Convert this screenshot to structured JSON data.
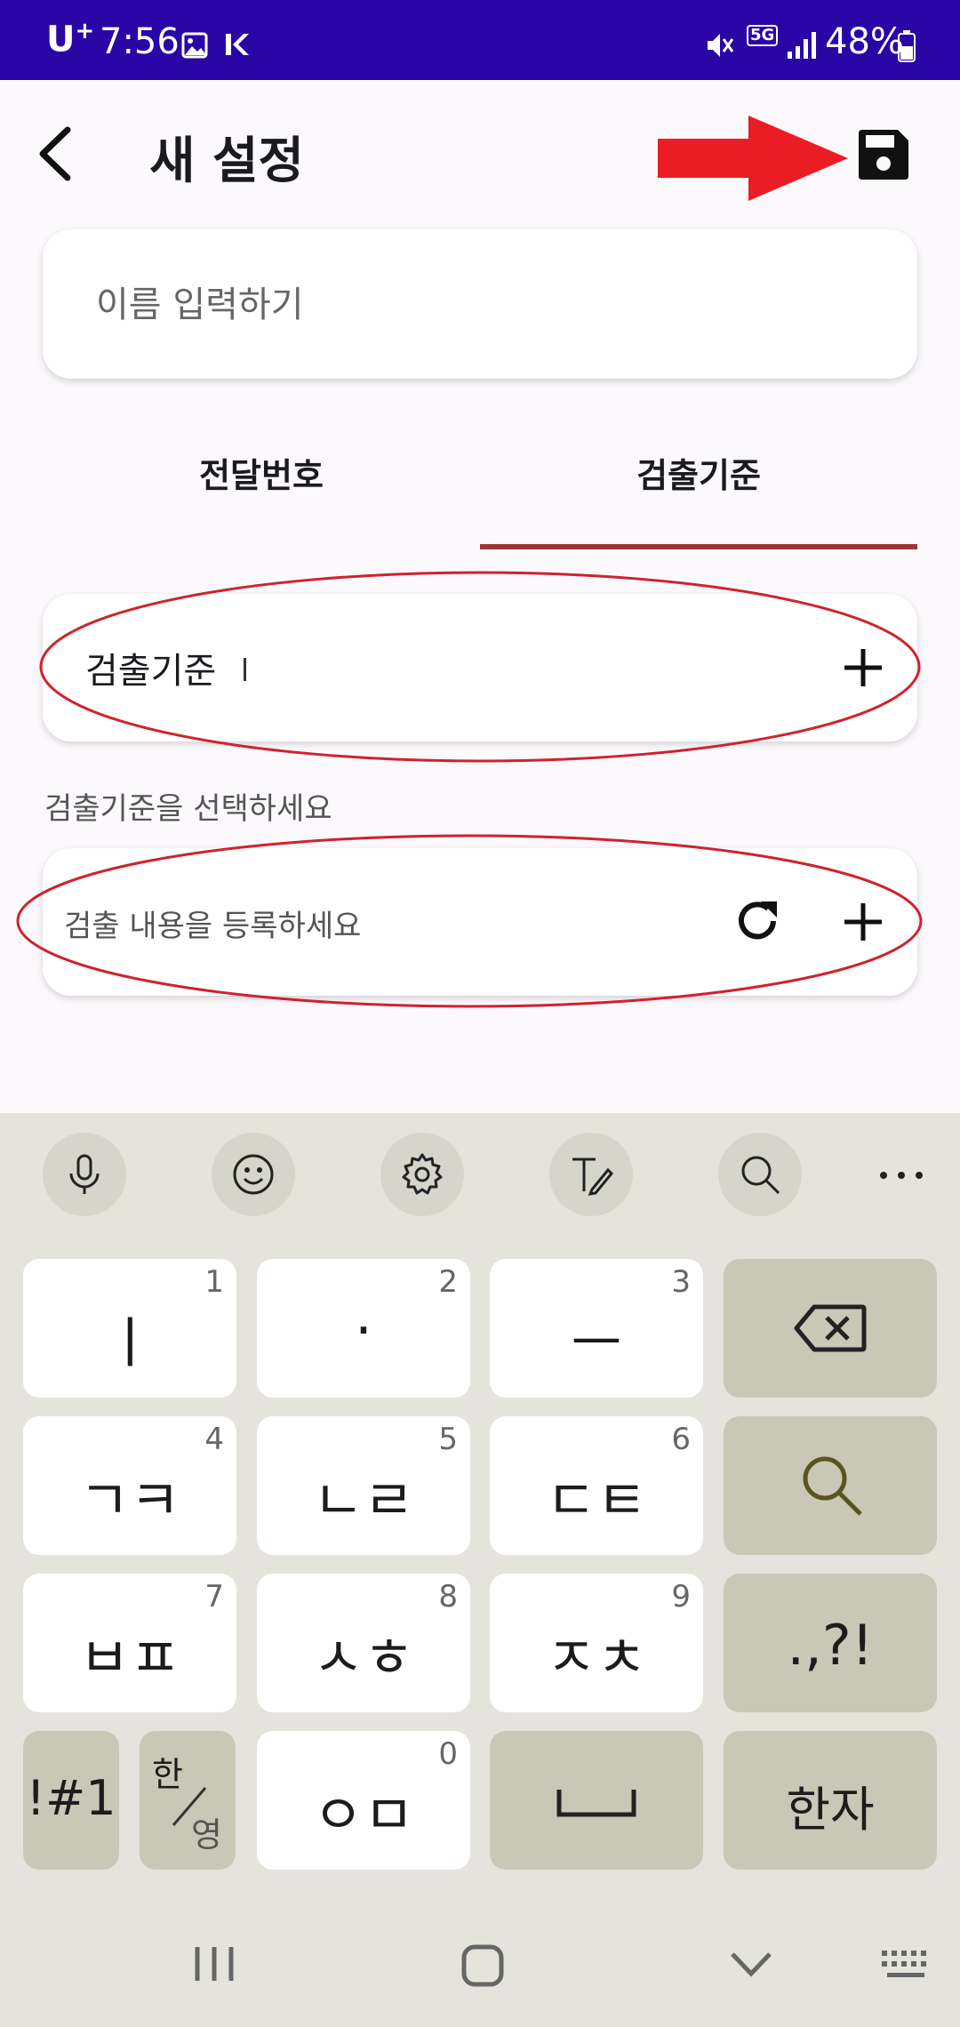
{
  "status_bar": {
    "carrier": "U",
    "carrier_sup": "+",
    "time": "7:56",
    "network": "5G",
    "battery": "48%"
  },
  "app_bar": {
    "title": "새 설정"
  },
  "name_field": {
    "placeholder": "이름 입력하기"
  },
  "tabs": [
    {
      "label": "전달번호",
      "selected": false
    },
    {
      "label": "검출기준",
      "selected": true
    }
  ],
  "criteria_row": {
    "label": "검출기준"
  },
  "helper_text": "검출기준을 선택하세요",
  "content_row": {
    "placeholder": "검출 내용을 등록하세요"
  },
  "keyboard": {
    "toolbar": [
      "mic-icon",
      "emoji-icon",
      "settings-icon",
      "text-style-icon",
      "search-icon",
      "more-icon"
    ],
    "keys": {
      "k1": {
        "label": "ㅣ",
        "num": "1"
      },
      "k2": {
        "label": "·",
        "num": "2"
      },
      "k3": {
        "label": "ㅡ",
        "num": "3"
      },
      "k4": {
        "label": "ㄱㅋ",
        "num": "4"
      },
      "k5": {
        "label": "ㄴㄹ",
        "num": "5"
      },
      "k6": {
        "label": "ㄷㅌ",
        "num": "6"
      },
      "k7": {
        "label": "ㅂㅍ",
        "num": "7"
      },
      "k8": {
        "label": "ㅅㅎ",
        "num": "8"
      },
      "k9": {
        "label": "ㅈㅊ",
        "num": "9"
      },
      "k0": {
        "label": "ㅇㅁ",
        "num": "0"
      },
      "punct": ".,?!",
      "symbols": "!#1",
      "lang_top": "한",
      "lang_bottom": "영",
      "hanja": "한자"
    }
  },
  "colors": {
    "status_bar": "#2a06a6",
    "tab_indicator": "#9e3636",
    "annotation": "#d0222c",
    "keyboard_bg": "#e5e4dc",
    "key_dark": "#c9c8b6"
  }
}
